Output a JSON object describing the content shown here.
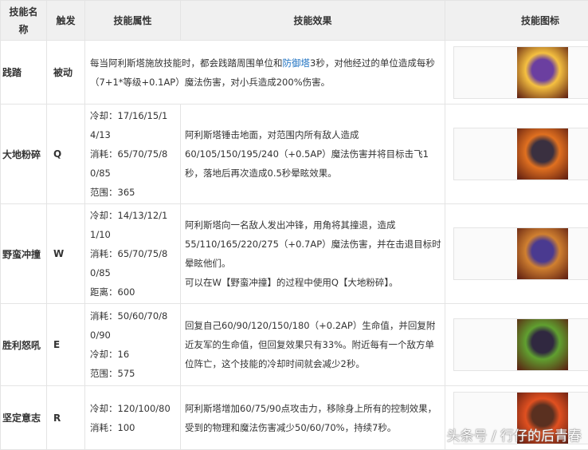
{
  "headers": [
    "技能名称",
    "触发",
    "技能属性",
    "技能效果",
    "技能图标"
  ],
  "rows": [
    {
      "name": "践踏",
      "trigger": "被动",
      "attrs": [],
      "effect_parts": [
        "每当阿利斯塔施放技能时，都会践踏周围单位和",
        "防御塔",
        "3秒，对他经过的单位造成每秒（7+1*等级+0.1AP）魔法伤害，对小兵造成200%伤害。"
      ],
      "icon": "trample-icon",
      "colors": [
        "#f5c040",
        "#6b3fa0"
      ]
    },
    {
      "name": "大地粉碎",
      "trigger": "Q",
      "attrs": [
        "冷却：17/16/15/14/13",
        "消耗：65/70/75/80/85",
        "范围：365"
      ],
      "effect": "阿利斯塔锤击地面，对范围内所有敌人造成60/105/150/195/240（+0.5AP）魔法伤害并将目标击飞1秒，落地后再次造成0.5秒晕眩效果。",
      "icon": "pulverize-icon",
      "colors": [
        "#e07020",
        "#3a3040"
      ]
    },
    {
      "name": "野蛮冲撞",
      "trigger": "W",
      "attrs": [
        "冷却：14/13/12/11/10",
        "消耗：65/70/75/80/85",
        "距离：600"
      ],
      "effect": "阿利斯塔向一名敌人发出冲锋，用角将其撞退，造成55/110/165/220/275（+0.7AP）魔法伤害，并在击退目标时晕眩他们。",
      "effect2": "可以在W【野蛮冲撞】的过程中使用Q【大地粉碎】。",
      "icon": "headbutt-icon",
      "colors": [
        "#d08030",
        "#4a3a90"
      ]
    },
    {
      "name": "胜利怒吼",
      "trigger": "E",
      "attrs": [
        "消耗：50/60/70/80/90",
        "冷却：16",
        "范围：575"
      ],
      "effect": "回复自己60/90/120/150/180（+0.2AP）生命值，并回复附近友军的生命值，但回复效果只有33%。附近每有一个敌方单位阵亡，这个技能的冷却时间就会减少2秒。",
      "icon": "triumphant-roar-icon",
      "colors": [
        "#60a030",
        "#302840"
      ]
    },
    {
      "name": "坚定意志",
      "trigger": "R",
      "attrs": [
        "冷却：120/100/80",
        "消耗：100"
      ],
      "effect": "阿利斯塔增加60/75/90点攻击力，移除身上所有的控制效果，受到的物理和魔法伤害减少50/60/70%，持续7秒。",
      "icon": "unbreakable-will-icon",
      "colors": [
        "#e05020",
        "#5a3020"
      ]
    }
  ],
  "watermark": "头条号 / 行仔的后青春"
}
